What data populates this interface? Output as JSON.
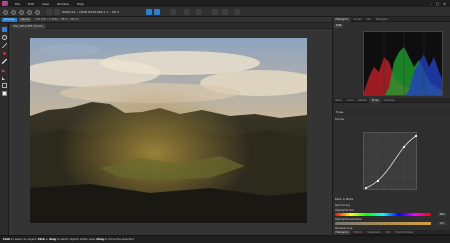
{
  "menubar": {
    "items": [
      "File",
      "Edit",
      "View",
      "Window",
      "Help"
    ]
  },
  "toolbar": {
    "info_text": "RGBA/16 • sRGB IEC61966-2.1 • f/8.0"
  },
  "context": {
    "buttons": [
      "Develop",
      "Cancel"
    ],
    "info_text": "ISO 100 • 1/160s • f/8.0 • 35mm"
  },
  "document": {
    "tab_label": "DSC_0051.NEF (25.0%)"
  },
  "status": {
    "segments": [
      {
        "key": "Click",
        "text": "to select an object."
      },
      {
        "key": "Click + drag",
        "text": "to select objects within area."
      },
      {
        "key": "Drag",
        "text": "to move the selection."
      }
    ]
  },
  "right_panel": {
    "top_tabs": [
      "Histogram",
      "Scope",
      "Info",
      "Navigator"
    ],
    "top_tab_active": 0,
    "histogram_selector": "RGB",
    "mid_tabs": [
      "Basic",
      "Lens",
      "Details",
      "Tones",
      "Overlays"
    ],
    "mid_tab_active": 3,
    "adjustment_title": "Curves",
    "curves_label": "Curves",
    "tones_label": "Tones",
    "row_labels": [
      "Black & White",
      "Split toning"
    ],
    "slider_rows": [
      {
        "label": "Highlights hue",
        "value": "38.0"
      },
      {
        "label": "Highlights saturation",
        "value": "0%"
      },
      {
        "label": "Shadows hue",
        "value": "0.0"
      }
    ],
    "bottom_tabs": [
      "Histogram",
      "History",
      "Snapshots",
      "Info",
      "32-bit Preview"
    ],
    "bottom_tab_active": 0
  },
  "colors": {
    "accent": "#2f7fd0",
    "panel_bg": "#2e2e2e",
    "canvas_bg": "#343434"
  }
}
